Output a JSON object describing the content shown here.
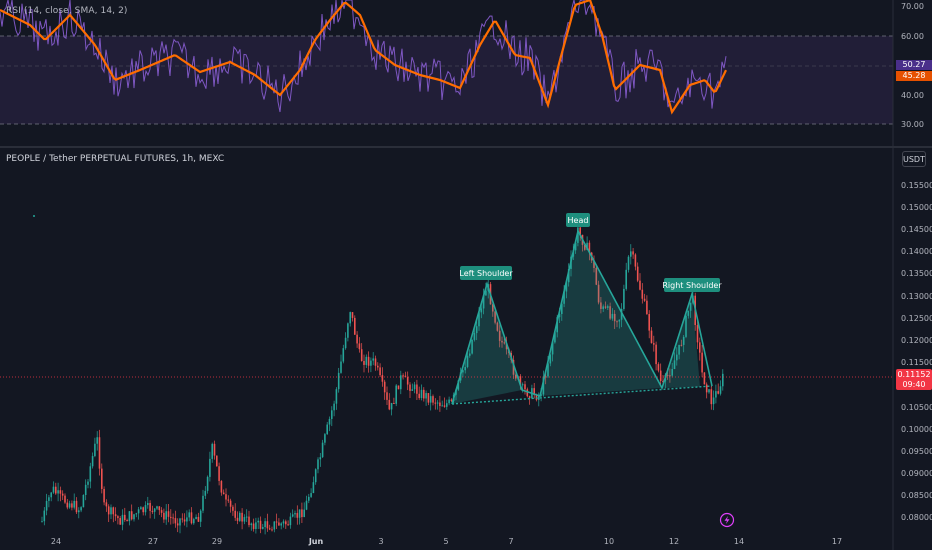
{
  "rsi": {
    "legend": "RSI (14, close, SMA, 14, 2)",
    "levels": [
      "70.00",
      "60.00",
      "50.00",
      "40.00",
      "30.00"
    ],
    "value_tag": "50.27",
    "sma_tag": "45.28",
    "colors": {
      "rsi": "#7e57c2",
      "sma": "#ff6d00",
      "band": "#2a2343"
    }
  },
  "chart": {
    "title": "PEOPLE / Tether PERPETUAL FUTURES, 1h, MEXC",
    "currency": "USDT",
    "price_labels": [
      "0.15500",
      "0.15000",
      "0.14500",
      "0.14000",
      "0.13500",
      "0.13000",
      "0.12500",
      "0.12000",
      "0.11500",
      "0.10500",
      "0.10000",
      "0.09500",
      "0.09000",
      "0.08500",
      "0.08000"
    ],
    "last_price": "0.11152",
    "countdown": "09:40",
    "date_labels": [
      "24",
      "27",
      "29",
      "Jun",
      "3",
      "5",
      "7",
      "10",
      "12",
      "14",
      "17"
    ],
    "colors": {
      "up": "#26a69a",
      "down": "#ef5350",
      "pattern": "#26a69a",
      "last": "#f23645"
    }
  },
  "annotations": {
    "left_shoulder": "Left Shoulder",
    "head": "Head",
    "right_shoulder": "Right Shoulder"
  },
  "icons": {
    "lightning": "lightning-icon"
  }
}
